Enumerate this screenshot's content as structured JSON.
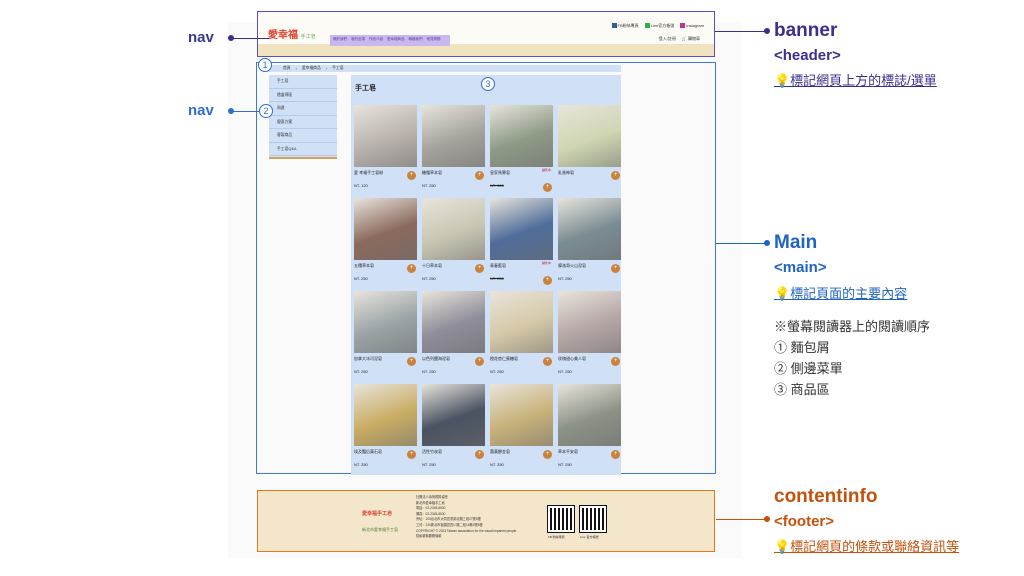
{
  "annotations": {
    "banner": {
      "title": "banner",
      "tag": "<header>",
      "note": "💡標記網頁上方的標誌/選單",
      "color": "#3a2f8e"
    },
    "main": {
      "title": "Main",
      "tag": "<main>",
      "note": "💡標記頁面的主要內容",
      "color": "#1f63c4"
    },
    "contentinfo": {
      "title": "contentinfo",
      "tag": "<footer>",
      "note": "💡標記網頁的條款或聯絡資訊等",
      "color": "#c4510c"
    },
    "nav1": "nav",
    "nav2": "nav",
    "reading_order": {
      "heading": "※螢幕閱讀器上的閱讀順序",
      "items": [
        "① 麵包屑",
        "② 側邊菜單",
        "③ 商品區"
      ]
    },
    "badges": [
      "1",
      "2",
      "3"
    ]
  },
  "header": {
    "logo": "愛幸福",
    "logo_sub": "手工皂",
    "nav_items": [
      "關於我們",
      "皂的品項",
      "作品介紹",
      "愛幸福商品",
      "聯絡我們",
      "常見問題"
    ],
    "social": [
      "FB粉絲專頁",
      "Line官方帳號",
      "Instagram"
    ],
    "account": [
      "登入/註冊",
      "購物車"
    ]
  },
  "breadcrumb": [
    "首頁",
    "愛幸福商品",
    "手工皂"
  ],
  "sidebar": [
    "手工皂",
    "禮盒專區",
    "周邊",
    "優惠方案",
    "客製商品",
    "手工皂Q&A"
  ],
  "content": {
    "title": "手工皂",
    "products": [
      {
        "name": "愛 幸福手工皂粉",
        "price": "NT. 120",
        "color": "#b9b2ad"
      },
      {
        "name": "糖霜草本皂",
        "price": "NT. 250",
        "color": "#a4a39c"
      },
      {
        "name": "皇家馬賽皂",
        "price": "NT. 500",
        "strike": true,
        "tag": "銷售中",
        "color": "#8e9a86"
      },
      {
        "name": "乳香神皂",
        "price": "",
        "color": "#cfd6b2"
      },
      {
        "name": "五穗草本皂",
        "price": "NT. 250",
        "color": "#8b6a5e"
      },
      {
        "name": "十日草本皂",
        "price": "NT. 250",
        "color": "#c9c6b3"
      },
      {
        "name": "青春藍皂",
        "price": "NT. 250",
        "strike": true,
        "tag": "銷售中",
        "color": "#4f6d9a"
      },
      {
        "name": "摩洛哥火山泥皂",
        "price": "NT. 250",
        "color": "#7a8c93"
      },
      {
        "name": "加拿大冰河泥皂",
        "price": "NT. 250",
        "color": "#9aa3a6"
      },
      {
        "name": "以色列鹽海泥皂",
        "price": "NT. 250",
        "color": "#8f8d99"
      },
      {
        "name": "橙花杏仁蜜糖皂",
        "price": "NT. 250",
        "color": "#d6c9a8"
      },
      {
        "name": "玫瑰甜心美人皂",
        "price": "NT. 250",
        "color": "#b5a7a6"
      },
      {
        "name": "埃及豔后黃石皂",
        "price": "NT. 250",
        "color": "#c9ad64"
      },
      {
        "name": "活性竹炭皂",
        "price": "NT. 250",
        "color": "#4a5363"
      },
      {
        "name": "薑黃鬱金皂",
        "price": "NT. 250",
        "color": "#c8b27a"
      },
      {
        "name": "草本平安皂",
        "price": "NT. 250",
        "color": "#8c9287"
      }
    ]
  },
  "footer": {
    "logo1": "愛幸福手工皂",
    "logo2": "新北市愛幸福手工皂",
    "info": [
      "社團法人臺灣視障協會",
      "新北市愛幸福手工皂",
      "電話：02-2345-6630",
      "傳真：02-2345-6630",
      "會址：100台北市大同區重慶北路三段27號5樓",
      "工坊：220新北市板橋區四川路二段16巷3號5樓",
      "COPYRIGHT © 2023 Taiwan association for the visual impaired people.",
      "隱私權與服務條款"
    ],
    "qr": [
      "FB 粉絲專頁",
      "Line 官方帳號"
    ]
  }
}
